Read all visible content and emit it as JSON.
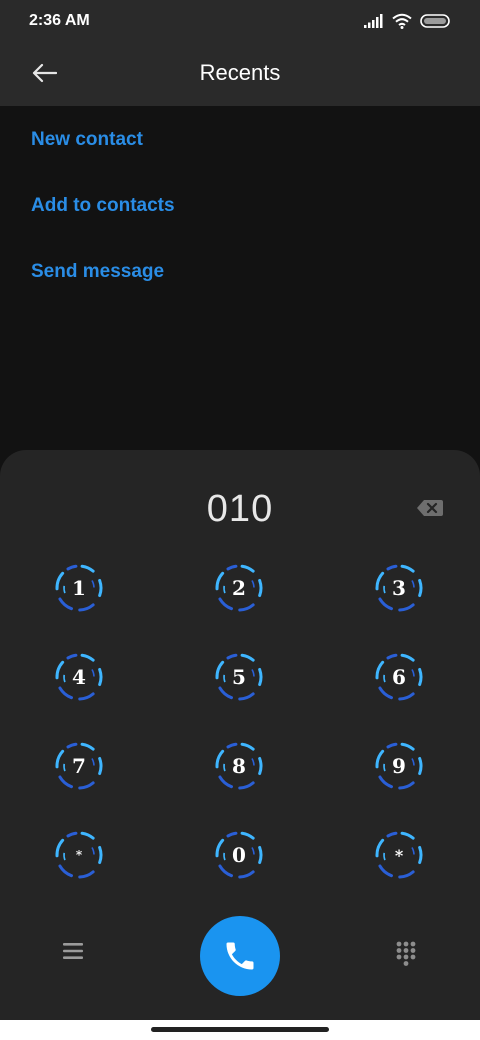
{
  "status_bar": {
    "time": "2:36 AM",
    "icons": [
      "signal-icon",
      "wifi-icon",
      "battery-icon"
    ]
  },
  "app_bar": {
    "title": "Recents",
    "back_icon": "arrow-left-icon"
  },
  "actions": [
    {
      "label": "New contact"
    },
    {
      "label": "Add to contacts"
    },
    {
      "label": "Send message"
    }
  ],
  "dialer": {
    "dialed_number": "010",
    "backspace_icon": "backspace-icon",
    "keys": [
      "1",
      "2",
      "3",
      "4",
      "5",
      "6",
      "7",
      "8",
      "9",
      "*",
      "0",
      "*"
    ],
    "left_icon": "menu-icon",
    "call_icon": "phone-icon",
    "right_icon": "dialpad-icon"
  },
  "colors": {
    "accent": "#2a8de6",
    "call_button": "#1a94f0",
    "ring_cyan": "#3fb6ff",
    "ring_blue": "#2a5fd6"
  }
}
